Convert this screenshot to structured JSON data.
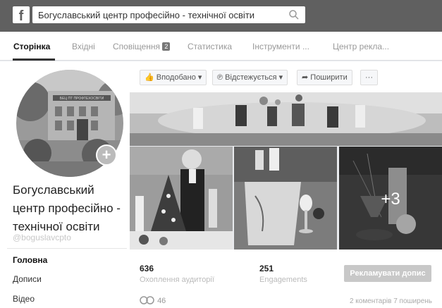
{
  "topbar": {
    "logo": "f",
    "search_value": "Богуславський центр професійно - технічної освіти"
  },
  "tabs": [
    {
      "label": "Сторінка"
    },
    {
      "label": "Вхідні"
    },
    {
      "label": "Сповіщення",
      "badge": "2"
    },
    {
      "label": "Статистика"
    },
    {
      "label": "Інструменти ..."
    },
    {
      "label": "Центр рекла..."
    }
  ],
  "profile": {
    "name_lines": [
      "Богуславський",
      "центр професійно -",
      "технічної освіти"
    ],
    "handle": "@boguslavcpto",
    "building_sign": "БЕЦ ПТ ПРОФТЕХОСВІТИ",
    "plus": "+"
  },
  "nav": [
    {
      "label": "Головна"
    },
    {
      "label": "Дописи"
    },
    {
      "label": "Відео"
    }
  ],
  "actions": {
    "like": "Вподобано",
    "follow": "Відстежується",
    "share": "Поширити",
    "more": "···"
  },
  "photos": {
    "more_count": "+3"
  },
  "stats": {
    "reach_value": "636",
    "reach_label": "Охоплення аудиторії",
    "engagements_value": "251",
    "engagements_label": "Engagements",
    "promote_label": "Рекламувати допис",
    "reactions_count": "46",
    "meta": "2 коментарів 7 поширень"
  }
}
